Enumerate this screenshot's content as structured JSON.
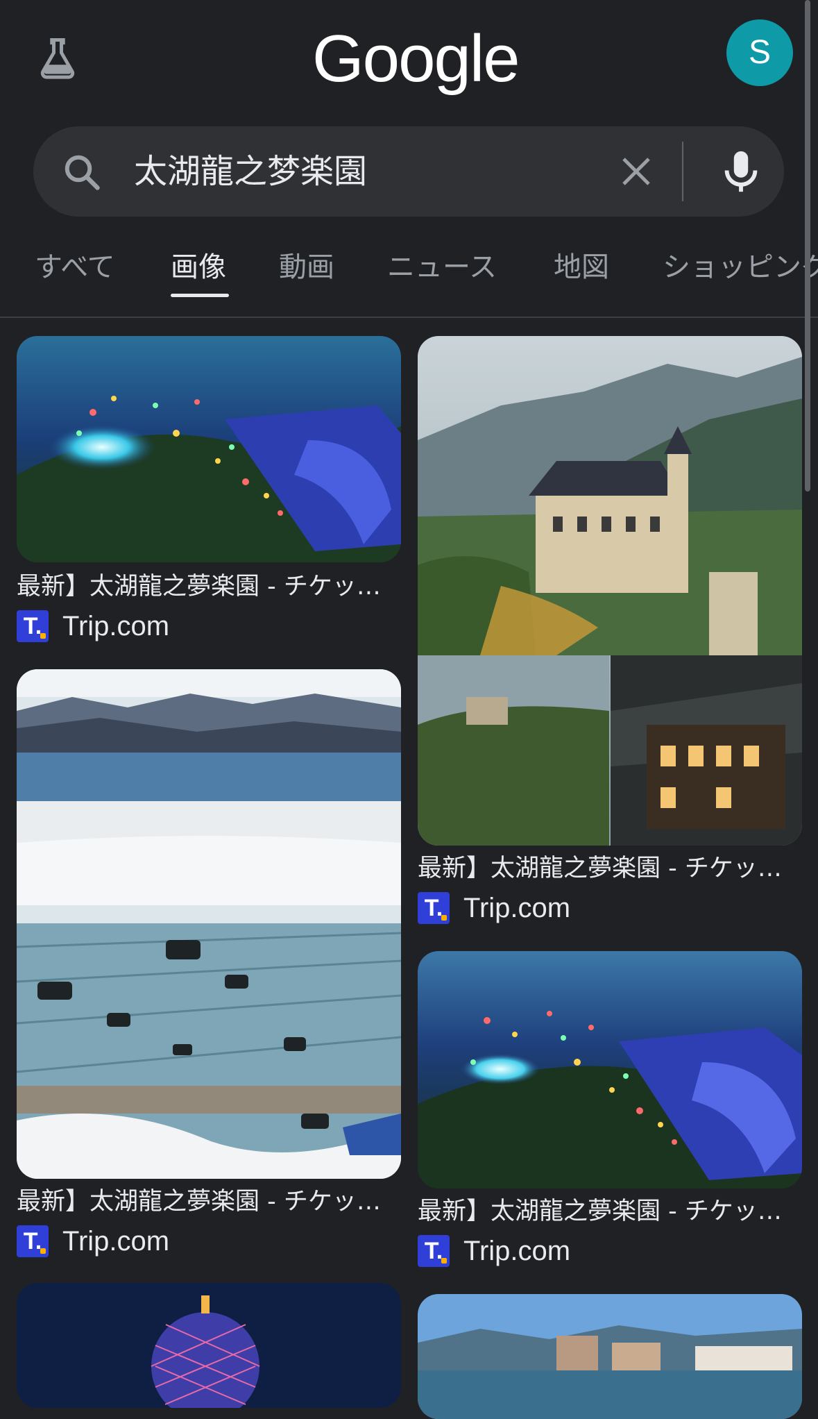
{
  "header": {
    "logo": "Google",
    "avatar_letter": "S",
    "labs_icon": "labs-flask-icon"
  },
  "search": {
    "query": "太湖龍之梦楽園"
  },
  "tabs": [
    {
      "label": "すべて"
    },
    {
      "label": "画像"
    },
    {
      "label": "動画"
    },
    {
      "label": "ニュース"
    },
    {
      "label": "地図"
    },
    {
      "label": "ショッピング"
    }
  ],
  "active_tab": "画像",
  "colors": {
    "background": "#202124",
    "search_bar": "#303134",
    "avatar": "#0f9aa8",
    "favicon": "#2f3fd8"
  },
  "results": [
    {
      "caption": "最新】太湖龍之夢楽園 - チケッ…",
      "source": "Trip.com",
      "favicon_letter": "T."
    },
    {
      "caption": "最新】太湖龍之夢楽園 - チケッ…",
      "source": "Trip.com",
      "favicon_letter": "T."
    },
    {
      "caption": "最新】太湖龍之夢楽園 - チケッ…",
      "source": "Trip.com",
      "favicon_letter": "T."
    },
    {
      "caption": "最新】太湖龍之夢楽園 - チケッ…",
      "source": "Trip.com",
      "favicon_letter": "T."
    }
  ]
}
